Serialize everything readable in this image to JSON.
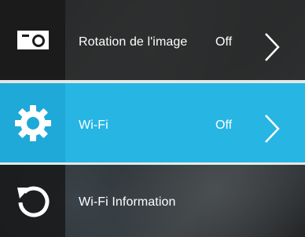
{
  "menu": {
    "items": [
      {
        "label": "Rotation de l'image",
        "value": "Off",
        "icon": "camera-rotation-icon"
      },
      {
        "label": "Wi-Fi",
        "value": "Off",
        "icon": "gear-icon"
      },
      {
        "label": "Wi-Fi Information",
        "value": "",
        "icon": "reset-icon"
      }
    ],
    "selected_index": 1
  },
  "colors": {
    "selected_row": "#27b5e4",
    "icon_panel_dark": "#1b1b1b",
    "text": "#ffffff"
  }
}
